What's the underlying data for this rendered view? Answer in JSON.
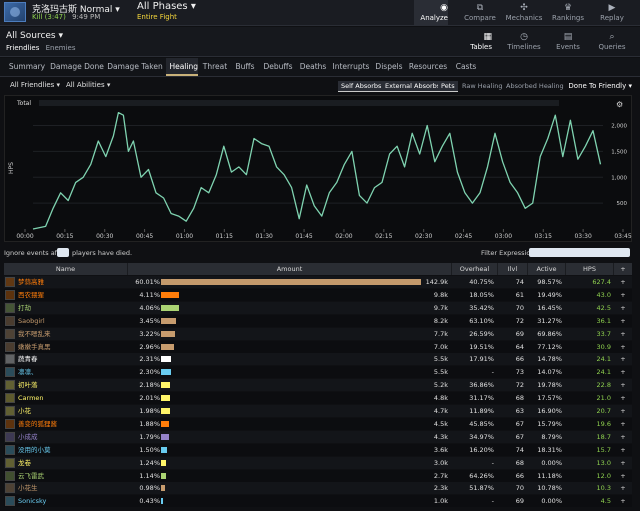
{
  "header": {
    "boss_name": "克洛玛古斯 Normal ▾",
    "kill_label": "Kill (3:47)",
    "time_label": "9:49 PM",
    "phase_name": "All Phases ▾",
    "phase_sub": "Entire Fight",
    "nav": [
      {
        "label": "Analyze",
        "icon": "eye-icon",
        "glyph": "◉"
      },
      {
        "label": "Compare",
        "icon": "compare-icon",
        "glyph": "⧉"
      },
      {
        "label": "Mechanics",
        "icon": "puzzle-icon",
        "glyph": "✣"
      },
      {
        "label": "Rankings",
        "icon": "trophy-icon",
        "glyph": "♛"
      },
      {
        "label": "Replay",
        "icon": "play-icon",
        "glyph": "▶"
      }
    ]
  },
  "sources": {
    "title": "All Sources ▾",
    "friendlies": "Friendlies",
    "enemies": "Enemies"
  },
  "views": [
    {
      "label": "Tables",
      "icon": "grid-icon",
      "glyph": "▦"
    },
    {
      "label": "Timelines",
      "icon": "clock-icon",
      "glyph": "◷"
    },
    {
      "label": "Events",
      "icon": "calendar-icon",
      "glyph": "▤"
    },
    {
      "label": "Queries",
      "icon": "search-icon",
      "glyph": "⌕"
    }
  ],
  "tabs": [
    "Summary",
    "Damage Done",
    "Damage Taken",
    "Healing",
    "Threat",
    "Buffs",
    "Debuffs",
    "Deaths",
    "Interrupts",
    "Dispels",
    "Resources",
    "Casts"
  ],
  "active_tab": "Healing",
  "filters": {
    "friendlies": "All Friendlies ▾",
    "abilities": "All Abilities ▾",
    "pills": [
      "Self Absorbs",
      "External Absorbs",
      "Pets",
      "Raw Healing",
      "Absorbed Healing"
    ],
    "done_to": "Done To Friendly ▾"
  },
  "ignore": {
    "prefix": "Ignore events after",
    "suffix": "players have died.",
    "filter_label": "Filter Expression:"
  },
  "chart_data": {
    "type": "line",
    "ylabel": "HPS",
    "legend_first": "Total",
    "x_ticks": [
      "00:00",
      "00:15",
      "00:30",
      "00:45",
      "01:00",
      "01:15",
      "01:30",
      "01:45",
      "02:00",
      "02:15",
      "02:30",
      "02:45",
      "03:00",
      "03:15",
      "03:30",
      "03:45"
    ],
    "y_ticks": [
      "500",
      "1,000",
      "1,500",
      "2,000"
    ],
    "ylim": [
      0,
      2300
    ],
    "xlim": [
      0,
      227
    ],
    "color": "#7fd3b0",
    "x": [
      0,
      5,
      8,
      11,
      14,
      17,
      20,
      23,
      26,
      29,
      32,
      34,
      36,
      38,
      40,
      43,
      46,
      49,
      52,
      55,
      58,
      61,
      64,
      67,
      70,
      73,
      76,
      79,
      82,
      85,
      88,
      91,
      94,
      97,
      100,
      103,
      106,
      109,
      112,
      115,
      118,
      121,
      124,
      127,
      130,
      133,
      136,
      139,
      142,
      145,
      148,
      151,
      154,
      157,
      160,
      163,
      166,
      169,
      172,
      175,
      178,
      181,
      184,
      187,
      190,
      193,
      196,
      199,
      202,
      205,
      208,
      211,
      214,
      217,
      220,
      223,
      226
    ],
    "values": [
      0,
      50,
      400,
      700,
      550,
      900,
      1000,
      1250,
      1700,
      1400,
      1800,
      2250,
      2200,
      1500,
      1700,
      1000,
      1150,
      700,
      600,
      300,
      250,
      150,
      400,
      800,
      700,
      1050,
      1600,
      1100,
      1200,
      1050,
      1750,
      1650,
      1600,
      1200,
      1050,
      800,
      200,
      850,
      450,
      250,
      700,
      900,
      1250,
      1500,
      650,
      500,
      800,
      900,
      1450,
      1600,
      1200,
      1850,
      1450,
      2000,
      1300,
      1600,
      1850,
      1100,
      700,
      500,
      700,
      1200,
      1850,
      1300,
      900,
      700,
      400,
      500,
      1400,
      1750,
      2200,
      1400,
      2100,
      1350,
      1600,
      1900,
      1250
    ]
  },
  "table": {
    "headers": [
      "Name",
      "Amount",
      "Overheal",
      "Ilvl",
      "Active",
      "HPS",
      "+"
    ],
    "rows": [
      {
        "name": "梦蒜高雅",
        "color": "#ff7d0a",
        "pct": "60.01%",
        "bar": 0.6001,
        "bar_color": "#c49a6c",
        "amount": "142.9k",
        "overheal": "40.75%",
        "ilvl": "74",
        "active": "98.57%",
        "hps": "627.4"
      },
      {
        "name": "西农猥猩",
        "color": "#ff7d0a",
        "pct": "4.11%",
        "bar": 0.0411,
        "bar_color": "#ff7d0a",
        "amount": "9.8k",
        "overheal": "18.05%",
        "ilvl": "61",
        "active": "19.49%",
        "hps": "43.0"
      },
      {
        "name": "打劫",
        "color": "#abd473",
        "pct": "4.06%",
        "bar": 0.0406,
        "bar_color": "#abd473",
        "amount": "9.7k",
        "overheal": "35.42%",
        "ilvl": "70",
        "active": "16.45%",
        "hps": "42.5"
      },
      {
        "name": "Saobgirl",
        "color": "#c79c6e",
        "pct": "3.45%",
        "bar": 0.0345,
        "bar_color": "#c79c6e",
        "amount": "8.2k",
        "overheal": "63.10%",
        "ilvl": "72",
        "active": "31.27%",
        "hps": "36.1"
      },
      {
        "name": "我不嗯乱来",
        "color": "#c79c6e",
        "pct": "3.22%",
        "bar": 0.0322,
        "bar_color": "#c79c6e",
        "amount": "7.7k",
        "overheal": "26.59%",
        "ilvl": "69",
        "active": "69.86%",
        "hps": "33.7"
      },
      {
        "name": "嫩嫩手真黑",
        "color": "#c79c6e",
        "pct": "2.96%",
        "bar": 0.0296,
        "bar_color": "#c79c6e",
        "amount": "7.0k",
        "overheal": "19.51%",
        "ilvl": "64",
        "active": "77.12%",
        "hps": "30.9"
      },
      {
        "name": "蔬青春",
        "color": "#ffffff",
        "pct": "2.31%",
        "bar": 0.0231,
        "bar_color": "#ffffff",
        "amount": "5.5k",
        "overheal": "17.91%",
        "ilvl": "66",
        "active": "14.78%",
        "hps": "24.1"
      },
      {
        "name": "凛凛、",
        "color": "#69ccf0",
        "pct": "2.30%",
        "bar": 0.023,
        "bar_color": "#69ccf0",
        "amount": "5.5k",
        "overheal": "-",
        "ilvl": "73",
        "active": "14.07%",
        "hps": "24.1"
      },
      {
        "name": "初叶落",
        "color": "#fff569",
        "pct": "2.18%",
        "bar": 0.0218,
        "bar_color": "#fff569",
        "amount": "5.2k",
        "overheal": "36.86%",
        "ilvl": "72",
        "active": "19.78%",
        "hps": "22.8"
      },
      {
        "name": "Carmen",
        "color": "#fff569",
        "pct": "2.01%",
        "bar": 0.0201,
        "bar_color": "#fff569",
        "amount": "4.8k",
        "overheal": "31.17%",
        "ilvl": "68",
        "active": "17.57%",
        "hps": "21.0"
      },
      {
        "name": "小花",
        "color": "#fff569",
        "pct": "1.98%",
        "bar": 0.0198,
        "bar_color": "#fff569",
        "amount": "4.7k",
        "overheal": "11.89%",
        "ilvl": "63",
        "active": "16.90%",
        "hps": "20.7"
      },
      {
        "name": "善变的狐狸酱",
        "color": "#ff7d0a",
        "pct": "1.88%",
        "bar": 0.0188,
        "bar_color": "#ff7d0a",
        "amount": "4.5k",
        "overheal": "45.85%",
        "ilvl": "67",
        "active": "15.79%",
        "hps": "19.6"
      },
      {
        "name": "小成成",
        "color": "#9482c9",
        "pct": "1.79%",
        "bar": 0.0179,
        "bar_color": "#9482c9",
        "amount": "4.3k",
        "overheal": "34.97%",
        "ilvl": "67",
        "active": "8.79%",
        "hps": "18.7"
      },
      {
        "name": "没用的小莫",
        "color": "#69ccf0",
        "pct": "1.50%",
        "bar": 0.015,
        "bar_color": "#69ccf0",
        "amount": "3.6k",
        "overheal": "16.20%",
        "ilvl": "74",
        "active": "18.31%",
        "hps": "15.7"
      },
      {
        "name": "龙卷",
        "color": "#fff569",
        "pct": "1.24%",
        "bar": 0.0124,
        "bar_color": "#fff569",
        "amount": "3.0k",
        "overheal": "-",
        "ilvl": "68",
        "active": "0.00%",
        "hps": "13.0"
      },
      {
        "name": "云飞雷武",
        "color": "#abd473",
        "pct": "1.14%",
        "bar": 0.0114,
        "bar_color": "#abd473",
        "amount": "2.7k",
        "overheal": "64.26%",
        "ilvl": "66",
        "active": "11.18%",
        "hps": "12.0"
      },
      {
        "name": "小花生",
        "color": "#c79c6e",
        "pct": "0.98%",
        "bar": 0.0098,
        "bar_color": "#c79c6e",
        "amount": "2.3k",
        "overheal": "51.87%",
        "ilvl": "70",
        "active": "10.78%",
        "hps": "10.3"
      },
      {
        "name": "Sonicsky",
        "color": "#69ccf0",
        "pct": "0.43%",
        "bar": 0.0043,
        "bar_color": "#69ccf0",
        "amount": "1.0k",
        "overheal": "-",
        "ilvl": "69",
        "active": "0.00%",
        "hps": "4.5"
      }
    ]
  }
}
